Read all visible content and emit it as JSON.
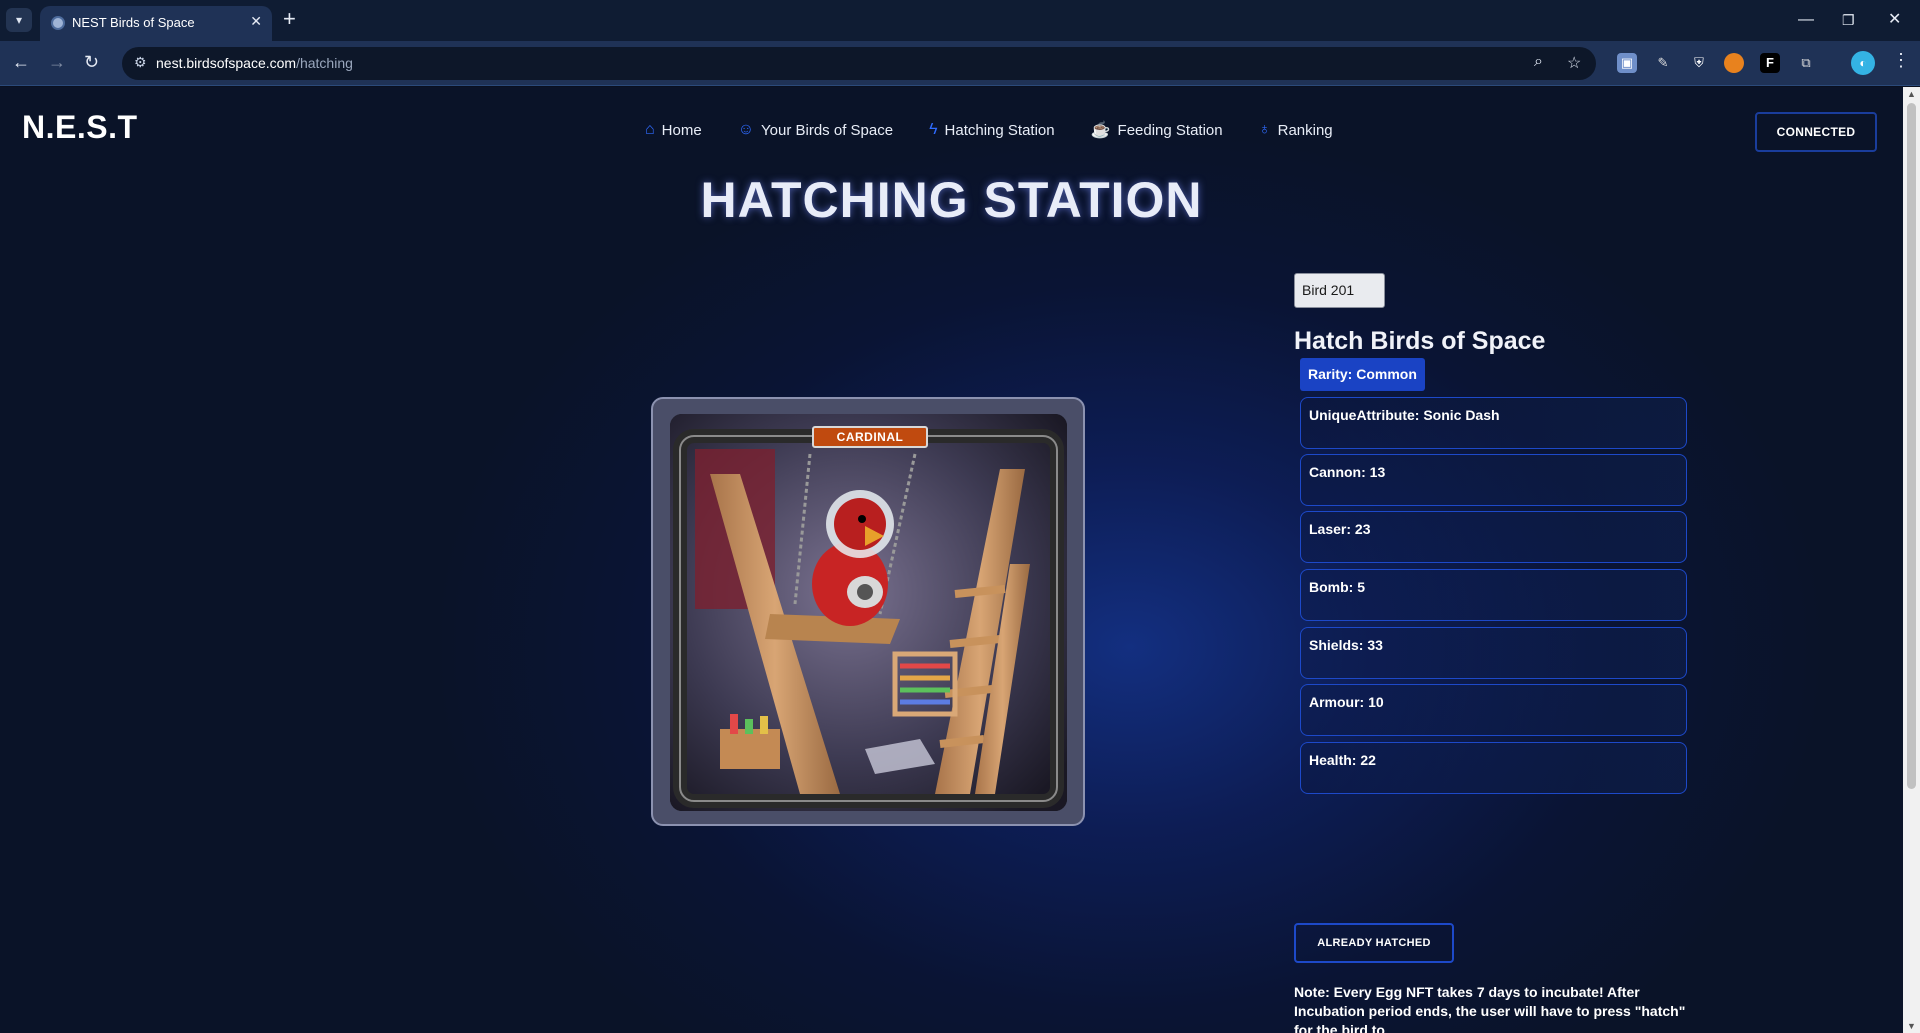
{
  "browser": {
    "tab_title": "NEST Birds of Space",
    "url_host": "nest.birdsofspace.com",
    "url_path": "/hatching"
  },
  "site": {
    "logo": "N.E.S.T",
    "nav": [
      {
        "label": "Home",
        "icon": "home-icon"
      },
      {
        "label": "Your Birds of Space",
        "icon": "user-icon"
      },
      {
        "label": "Hatching Station",
        "icon": "lightning-icon"
      },
      {
        "label": "Feeding Station",
        "icon": "cup-icon"
      },
      {
        "label": "Ranking",
        "icon": "award-icon"
      }
    ],
    "connect_label": "CONNECTED"
  },
  "page": {
    "title": "HATCHING STATION",
    "card": {
      "banner": "CARDINAL"
    },
    "bird_select": "Bird 201",
    "panel_title": "Hatch Birds of Space",
    "rarity": "Rarity: Common",
    "stats": [
      "UniqueAttribute: Sonic Dash",
      "Cannon: 13",
      "Laser: 23",
      "Bomb: 5",
      "Shields: 33",
      "Armour: 10",
      "Health: 22"
    ],
    "hatch_button": "ALREADY HATCHED",
    "note": "Note: Every Egg NFT takes 7 days to incubate! After Incubation period ends, the user will have to press \"hatch\" for the bird to"
  },
  "colors": {
    "accent": "#1d49c9",
    "rarity_bg": "#1a43c4",
    "banner": "#c04a0f"
  }
}
